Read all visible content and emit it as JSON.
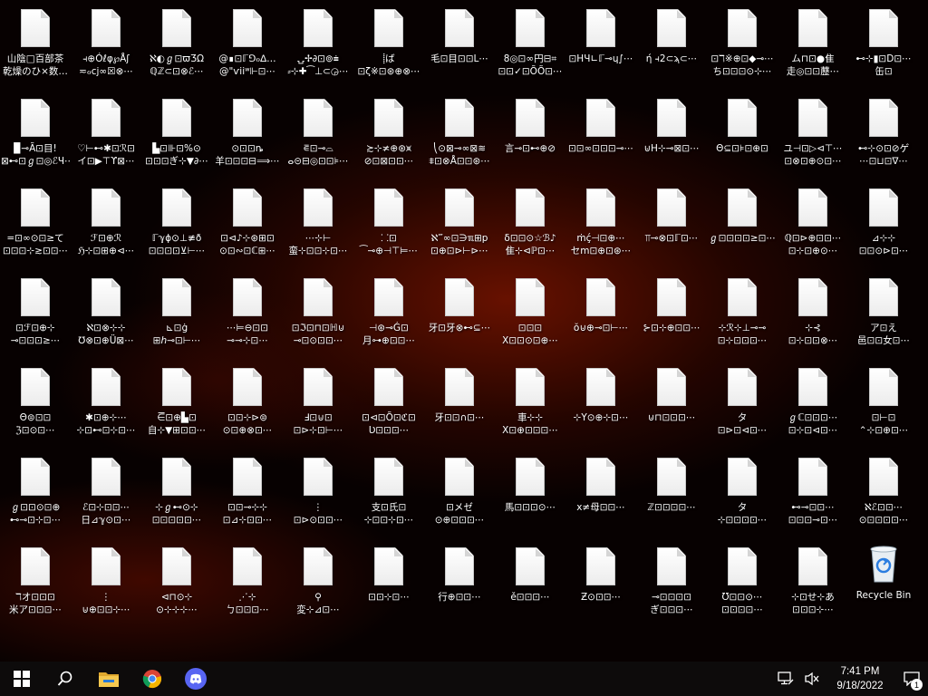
{
  "desktop": {
    "icons": [
      {
        "l1": "山陰□百部茶",
        "l2": "乾燥のひ×数…",
        "type": "file"
      },
      {
        "l1": "⫞⊕Óℓφ℘Åʃ",
        "l2": "≂ℴⅽϳ∞☒⊗⋯",
        "type": "file"
      },
      {
        "l1": "ℵ◐ℊ⊡ϖƷΩ",
        "l2": "ℚℤ⊂⊡⊗ℰ⋯",
        "type": "file"
      },
      {
        "l1": "@∎⊡ℾ⅁ℴ∆…",
        "l2": "@\"ѵiiʷ⊩⊡⋯",
        "type": "file"
      },
      {
        "l1": "⍽✢∂⊡⊚⩧",
        "l2": "⸗⊹✚⁀⊥⊂◶⋯",
        "type": "file"
      },
      {
        "l1": "⸽ば",
        "l2": "⊡ζ※⊡⊛⊕⊗⋯",
        "type": "file"
      },
      {
        "l1": "毛⊡目⊡⊡L⋯",
        "l2": "",
        "type": "file"
      },
      {
        "l1": "8◎⊡∞円⊟⌗",
        "l2": "⊡⊡✓⊡ÕÕ⊡⋯",
        "type": "file"
      },
      {
        "l1": "⊡HЧ∟ℾ⊸ɥ∫⋯",
        "l2": "",
        "type": "file"
      },
      {
        "l1": "ή ⫞2⊂ϡ⊂⋯",
        "l2": "",
        "type": "file"
      },
      {
        "l1": "⊡ℸ※⊕⊡◆⊸⋯",
        "l2": "ち⊡⊡⊡⊙⊹⋯",
        "type": "file"
      },
      {
        "l1": "ム⊓⊡●隹",
        "l2": "走◎⊡⊡藶⋯",
        "type": "file"
      },
      {
        "l1": "⊷⊹▮⊡D⊡⋯",
        "l2": "缶⊡",
        "type": "file"
      },
      {
        "l1": "▉⊸Ã⊡目!",
        "l2": "⊠⊷⊡ℊ⊡◎ℰЧ⋯",
        "type": "file"
      },
      {
        "l1": "♡⊢⊷✱⊡ℛ⊡",
        "l2": "イ⊡▶⊤ϒ⊠⋯",
        "type": "file"
      },
      {
        "l1": "▙⊡⊪⊡%⊙",
        "l2": "⊡⊡⊡ぎ⊹▼∂⋯",
        "type": "file"
      },
      {
        "l1": "⊙⊡⊡ȵ",
        "l2": "羊⊡⊡⊡⊟⟹⋯",
        "type": "file"
      },
      {
        "l1": "⋷⊡⊸⌓",
        "l2": "ⴰ⊝⊟◎⊡⊡⊧⋯",
        "type": "file"
      },
      {
        "l1": "≿⊹≭⊕⊛⩙",
        "l2": "⊘⊡⊠⊡⊡⋯",
        "type": "file"
      },
      {
        "l1": "⎝⊙⊠⊸∞⊠≋",
        "l2": "⩨⊡⊗Å⊡⊡⊛⋯",
        "type": "file"
      },
      {
        "l1": "言⊸⊡⊷⊕⊘",
        "l2": "",
        "type": "file"
      },
      {
        "l1": "⊡⊡∞⊡⊡⊡⊸⋯",
        "l2": "",
        "type": "file"
      },
      {
        "l1": "⊍H⊹⊸⊠⊡⋯",
        "l2": "",
        "type": "file"
      },
      {
        "l1": "Θ⊆⊡⊧⊡⊕⊡",
        "l2": "",
        "type": "file"
      },
      {
        "l1": "ユ⊣⊡▷⊲⊤⋯",
        "l2": "⊡⊗⊡⊕⊙⊡⋯",
        "type": "file"
      },
      {
        "l1": "⊷⊹⊙⊡⊘ゲ",
        "l2": "⋯⊡⊔⊡∇⋯",
        "type": "file"
      },
      {
        "l1": "=⊡∞⊙⊡≥て",
        "l2": "⊡⊡⊡⊹≳⊡⊡⋯",
        "type": "file"
      },
      {
        "l1": "ℱ⊡⊕ℛ",
        "l2": "ℌ⊹⊡⊞⊕⊲⋯",
        "type": "file"
      },
      {
        "l1": "ℾℽϕ⊙⊥≢ð",
        "l2": "⊡⊡⊡⊡⊻⊢⋯",
        "type": "file"
      },
      {
        "l1": "⊡⊲♪⊹⊛⊞⊡",
        "l2": "⊙⊡∾⊡ℂ⊞⋯",
        "type": "file"
      },
      {
        "l1": "⋯⊹⊢",
        "l2": "蛮⊹⊡⊡⊹⊡⋯",
        "type": "file"
      },
      {
        "l1": "⸬⊡",
        "l2": "⁀⊸⊕⊣⊤⊨⋯",
        "type": "file"
      },
      {
        "l1": "ℵ‴∞⊡∋ℼ⊞p",
        "l2": "⊡⊕⊡⊳⊢⊳⋯",
        "type": "file"
      },
      {
        "l1": "δ⊡⊡⊙☆ℬ♪",
        "l2": "隹⊹⊲ℙ⊡⋯",
        "type": "file"
      },
      {
        "l1": "ṁḉ⊣⊡⊕⋯",
        "l2": "セm⊡⊕⊡⊛⋯",
        "type": "file"
      },
      {
        "l1": "⫪⊸⊗⊡ℾ⊡⋯",
        "l2": "",
        "type": "file"
      },
      {
        "l1": "ℊ⊡⊡⊡⊡≥⊡⋯",
        "l2": "",
        "type": "file"
      },
      {
        "l1": "ℚ⊡⊳⊕⊡⊡⋯",
        "l2": "⊡⊹⊡⊕⊙⋯",
        "type": "file"
      },
      {
        "l1": "⊿⊹⊹",
        "l2": "⊡⊡⊙⊳⊡⋯",
        "type": "file"
      },
      {
        "l1": "⊡ℱ⊡⊕⊹",
        "l2": "⊸⊡⊡⊡≥⋯",
        "type": "file"
      },
      {
        "l1": "ℵ⊡⊗⊹⊹",
        "l2": "℧⊗⊡⊕Ü⊠⋯",
        "type": "file"
      },
      {
        "l1": "⊾⊡ġ",
        "l2": "⊞ℎ⊸⊡⊢⋯",
        "type": "file"
      },
      {
        "l1": "⋯⊨⊖⊡⊡",
        "l2": "⊸⊸⊹⊡⋯",
        "type": "file"
      },
      {
        "l1": "⊡ℑ⊡⊓⊡ℍ⊍",
        "l2": "⊸⊡⊙⊡⊡⋯",
        "type": "file"
      },
      {
        "l1": "⊣⊛⊸Ǵ⊡",
        "l2": "月⊶⊕⊡⊡⋯",
        "type": "file"
      },
      {
        "l1": "牙⊡牙⊗⊷⊆⋯",
        "l2": "",
        "type": "file"
      },
      {
        "l1": "⊡⊡⊡",
        "l2": "X⊡⊡⊙⊡⊕⋯",
        "type": "file"
      },
      {
        "l1": "ŏ⊍⊕⊸⊡⊢⋯",
        "l2": "",
        "type": "file"
      },
      {
        "l1": "⊱⊡⊹⊕⊡⊡⋯",
        "l2": "",
        "type": "file"
      },
      {
        "l1": "⊹ℛ⊹⊥⊸⊸",
        "l2": "⊡⊹⊡⊡⊡⋯",
        "type": "file"
      },
      {
        "l1": "⊹⊰",
        "l2": "⊡⊹⊡⊡⊗⋯",
        "type": "file"
      },
      {
        "l1": "ア⊡え",
        "l2": "邑⊡⊡女⊡⋯",
        "type": "file"
      },
      {
        "l1": "Θ⊜⊡⊡",
        "l2": "ℨ⊡⊙⊡⋯",
        "type": "file"
      },
      {
        "l1": "✱⊡⊕⊹⋯",
        "l2": "⊹⊡⊷⊡⊹⊡⋯",
        "type": "file"
      },
      {
        "l1": "⋶⊡⊕▙⊡",
        "l2": "自⊹▼⊞⊡⊡⋯",
        "type": "file"
      },
      {
        "l1": "⊡⊡⊹⊳⊜",
        "l2": "⊙⊡⊕⊗⊡⋯",
        "type": "file"
      },
      {
        "l1": "Ⅎ⊡⊍⊡",
        "l2": "⊡⊳⊹⊡⊢⋯",
        "type": "file"
      },
      {
        "l1": "⊡⊲⊡Õ⊡ℭ⊡",
        "l2": "Ʋ⊡⊡⊡⋯",
        "type": "file"
      },
      {
        "l1": "牙⊡⊡∩⊡⋯",
        "l2": "",
        "type": "file"
      },
      {
        "l1": "車⊹⊹",
        "l2": "X⊡⊕⊡⊡⊡⋯",
        "type": "file"
      },
      {
        "l1": "⊹Y⊙⊕⊹⊡⋯",
        "l2": "",
        "type": "file"
      },
      {
        "l1": "⊍⊓⊡⊡⊡⋯",
        "l2": "",
        "type": "file"
      },
      {
        "l1": "タ",
        "l2": "⊡⊳⊡⊲⊡⋯",
        "type": "file"
      },
      {
        "l1": "ℊℂ⊡⊡⊡⋯",
        "l2": "⊡⊹⊡⊲⊡⋯",
        "type": "file"
      },
      {
        "l1": "⊡⊢⊡",
        "l2": "⌃⊹⊡⊕⊡⋯",
        "type": "file"
      },
      {
        "l1": "ℊ⊡⊡⊙⊡⊕",
        "l2": "⊷⊸⊡⊹⊡⋯",
        "type": "file"
      },
      {
        "l1": "ℰ⊡⊹⊡⊡⋯",
        "l2": "日⊿ℽ⊙⊡⋯",
        "type": "file"
      },
      {
        "l1": "⊹ℊ⊷⊙⊹",
        "l2": "⊡⊡⊡⊡⊡⋯",
        "type": "file"
      },
      {
        "l1": "⊡⊡⊸⊹⊹",
        "l2": "⊡⊿⊹⊡⊡⋯",
        "type": "file"
      },
      {
        "l1": "⋮",
        "l2": "⊡⊳⊙⊡⊡⋯",
        "type": "file"
      },
      {
        "l1": "支⊡氏⊡",
        "l2": "⊹⊡⊡⊹⊡⋯",
        "type": "file"
      },
      {
        "l1": "⊡メゼ",
        "l2": "⊙⊕⊡⊡⊡⋯",
        "type": "file"
      },
      {
        "l1": "馬⊡⊡⊡⊙⋯",
        "l2": "",
        "type": "file"
      },
      {
        "l1": "x≠母⊡⊡⋯",
        "l2": "",
        "type": "file"
      },
      {
        "l1": "ℤ⊡⊡⊡⊡⋯",
        "l2": "",
        "type": "file"
      },
      {
        "l1": "タ",
        "l2": "⊹⊡⊡⊡⊡⋯",
        "type": "file"
      },
      {
        "l1": "⊷⊸⊡⊡⋯",
        "l2": "⊡⊡⊡⊸⊡⋯",
        "type": "file"
      },
      {
        "l1": "ℵℰ⊡⊡⋯",
        "l2": "⊙⊡⊡⊡⊡⋯",
        "type": "file"
      },
      {
        "l1": "ℸオ⊡⊡⊡",
        "l2": "米ア⊡⊡⊡⋯",
        "type": "file"
      },
      {
        "l1": "⋮",
        "l2": "⊍⊕⊡⊡⊹⋯",
        "type": "file"
      },
      {
        "l1": "⊲⊓⊙⊹",
        "l2": "⊙⊹⊹⊹⋯",
        "type": "file"
      },
      {
        "l1": "⋰⊹",
        "l2": "ㄅ⊡⊡⊡⋯",
        "type": "file"
      },
      {
        "l1": "⚲",
        "l2": "変⊹⊿⊡⋯",
        "type": "file"
      },
      {
        "l1": "⊡⊡⊹⊡⋯",
        "l2": "",
        "type": "file"
      },
      {
        "l1": "行⊕⊡⊡⋯",
        "l2": "",
        "type": "file"
      },
      {
        "l1": "ě⊡⊡⊡⋯",
        "l2": "",
        "type": "file"
      },
      {
        "l1": "Ƶ⊙⊡⊡⋯",
        "l2": "",
        "type": "file"
      },
      {
        "l1": "⊸⊡⊡⊡⊡",
        "l2": "ぎ⊡⊡⊡⋯",
        "type": "file"
      },
      {
        "l1": "Ʊ⊡⊡⊙⋯",
        "l2": "⊡⊡⊡⊡⋯",
        "type": "file"
      },
      {
        "l1": "⊹⊡せ⊹あ",
        "l2": "⊡⊡⊡⊹⋯",
        "type": "file"
      },
      {
        "l1": "Recycle Bin",
        "l2": "",
        "type": "recycle"
      }
    ]
  },
  "taskbar": {
    "apps": [
      {
        "name": "start-button",
        "icon": "windows-logo-icon"
      },
      {
        "name": "search-button",
        "icon": "search-icon"
      },
      {
        "name": "file-explorer-button",
        "icon": "folder-icon"
      },
      {
        "name": "chrome-button",
        "icon": "chrome-icon"
      },
      {
        "name": "discord-button",
        "icon": "discord-icon"
      }
    ],
    "clock": {
      "time": "7:41 PM",
      "date": "9/18/2022"
    },
    "notifications_count": "1",
    "colors": {
      "taskbar_bg": "#0d0b0b",
      "folder": "#f2c24b",
      "discord": "#5865f2"
    }
  }
}
